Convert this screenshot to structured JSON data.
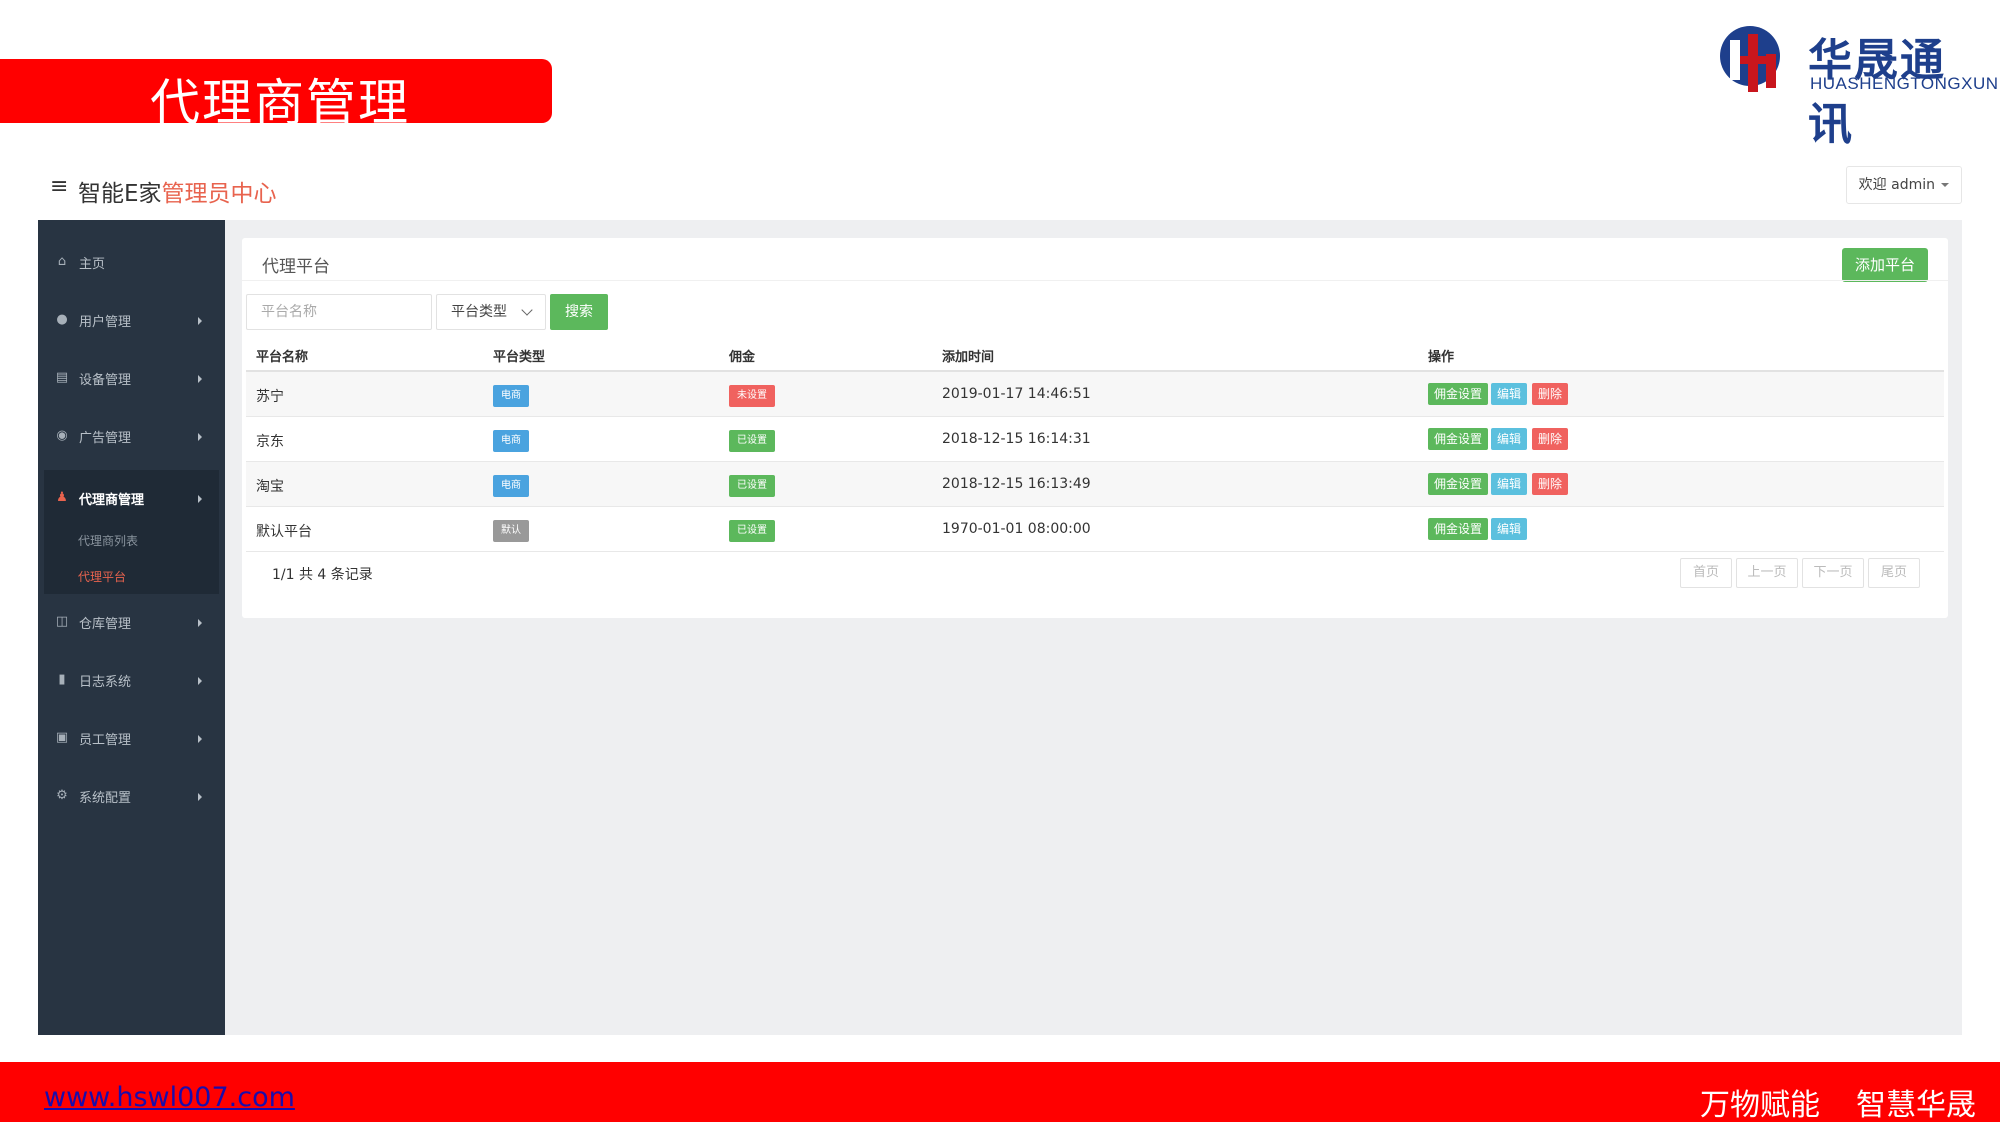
{
  "slide": {
    "title": "代理商管理",
    "logo_cn": "华晟通讯",
    "logo_en": "HUASHENGTONGXUN",
    "website": "www.hswl007.com",
    "slogan_left": "万物赋能",
    "slogan_right": "智慧华晟"
  },
  "header": {
    "brand_main": "智能E家",
    "brand_accent": "管理员中心",
    "user_label": "欢迎 admin"
  },
  "sidebar": {
    "items": [
      {
        "label": "主页",
        "icon": "home-icon"
      },
      {
        "label": "用户管理",
        "icon": "user-icon"
      },
      {
        "label": "设备管理",
        "icon": "device-icon"
      },
      {
        "label": "广告管理",
        "icon": "dashboard-icon"
      },
      {
        "label": "代理商管理",
        "icon": "users-icon"
      },
      {
        "label": "仓库管理",
        "icon": "columns-icon"
      },
      {
        "label": "日志系统",
        "icon": "book-icon"
      },
      {
        "label": "员工管理",
        "icon": "id-card-icon"
      },
      {
        "label": "系统配置",
        "icon": "gear-icon"
      }
    ],
    "submenu": [
      "代理商列表",
      "代理平台"
    ]
  },
  "panel": {
    "title": "代理平台",
    "add_button": "添加平台",
    "search_placeholder": "平台名称",
    "type_select": "平台类型",
    "search_button": "搜索"
  },
  "table": {
    "headers": [
      "平台名称",
      "平台类型",
      "佣金",
      "添加时间",
      "操作"
    ],
    "rows": [
      {
        "name": "苏宁",
        "type": "电商",
        "commission": "未设置",
        "time": "2019-01-17 14:46:51",
        "ops": [
          "佣金设置",
          "编辑",
          "删除"
        ]
      },
      {
        "name": "京东",
        "type": "电商",
        "commission": "已设置",
        "time": "2018-12-15 16:14:31",
        "ops": [
          "佣金设置",
          "编辑",
          "删除"
        ]
      },
      {
        "name": "淘宝",
        "type": "电商",
        "commission": "已设置",
        "time": "2018-12-15 16:13:49",
        "ops": [
          "佣金设置",
          "编辑",
          "删除"
        ]
      },
      {
        "name": "默认平台",
        "type": "默认",
        "commission": "已设置",
        "time": "1970-01-01 08:00:00",
        "ops": [
          "佣金设置",
          "编辑"
        ]
      }
    ],
    "record_count": "1/1 共 4 条记录",
    "pagination": [
      "首页",
      "上一页",
      "下一页",
      "尾页"
    ]
  },
  "colors": {
    "banner": "#ff0000",
    "sidebar": "#283442",
    "accent": "#e8634e",
    "success": "#5cb85c",
    "info": "#5bc0de",
    "danger": "#f0625f",
    "primary": "#4aa3df",
    "default": "#999999"
  }
}
